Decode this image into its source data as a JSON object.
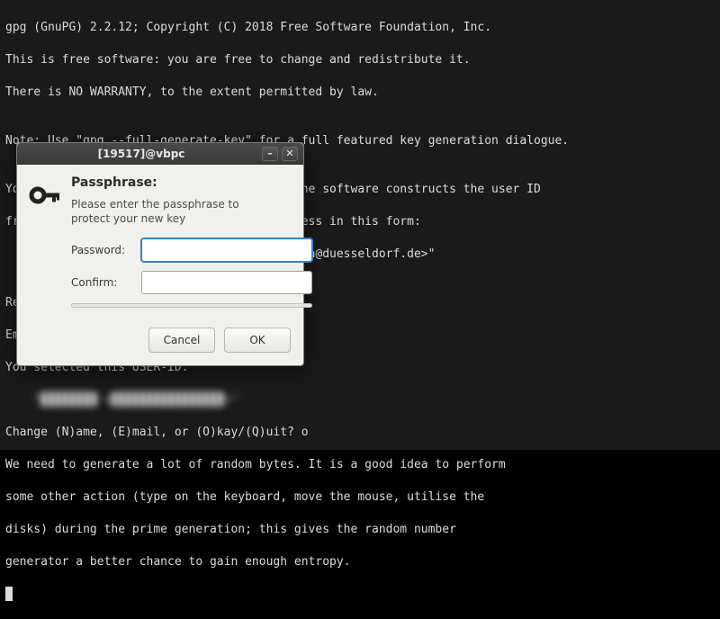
{
  "terminal": {
    "lines": [
      "gpg (GnuPG) 2.2.12; Copyright (C) 2018 Free Software Foundation, Inc.",
      "This is free software: you are free to change and redistribute it.",
      "There is NO WARRANTY, to the extent permitted by law.",
      "",
      "Note: Use \"gpg --full-generate-key\" for a full featured key generation dialogue.",
      "",
      "You need a user ID to identify your key; the software constructs the user ID",
      "from the Real Name, Comment and Email Address in this form:",
      "    \"Heinrich Heine (Der Dichter) <heinrichh@duesseldorf.de>\"",
      "",
      "Real name:",
      "Email address:",
      "You selected this USER-ID:",
      "",
      "Change (N)ame, (E)mail, or (O)kay/(Q)uit? o",
      "We need to generate a lot of random bytes. It is a good idea to perform",
      "some other action (type on the keyboard, move the mouse, utilise the",
      "disks) during the prime generation; this gives the random number",
      "generator a better chance to gain enough entropy."
    ]
  },
  "dialog": {
    "title": "[19517]@vbpc",
    "minimize_glyph": "–",
    "close_glyph": "✕",
    "heading": "Passphrase:",
    "description": "Please enter the passphrase to protect your new key",
    "password_label": "Password:",
    "confirm_label": "Confirm:",
    "password_value": "",
    "confirm_value": "",
    "cancel_label": "Cancel",
    "ok_label": "OK"
  },
  "icons": {
    "key": "key-icon"
  }
}
